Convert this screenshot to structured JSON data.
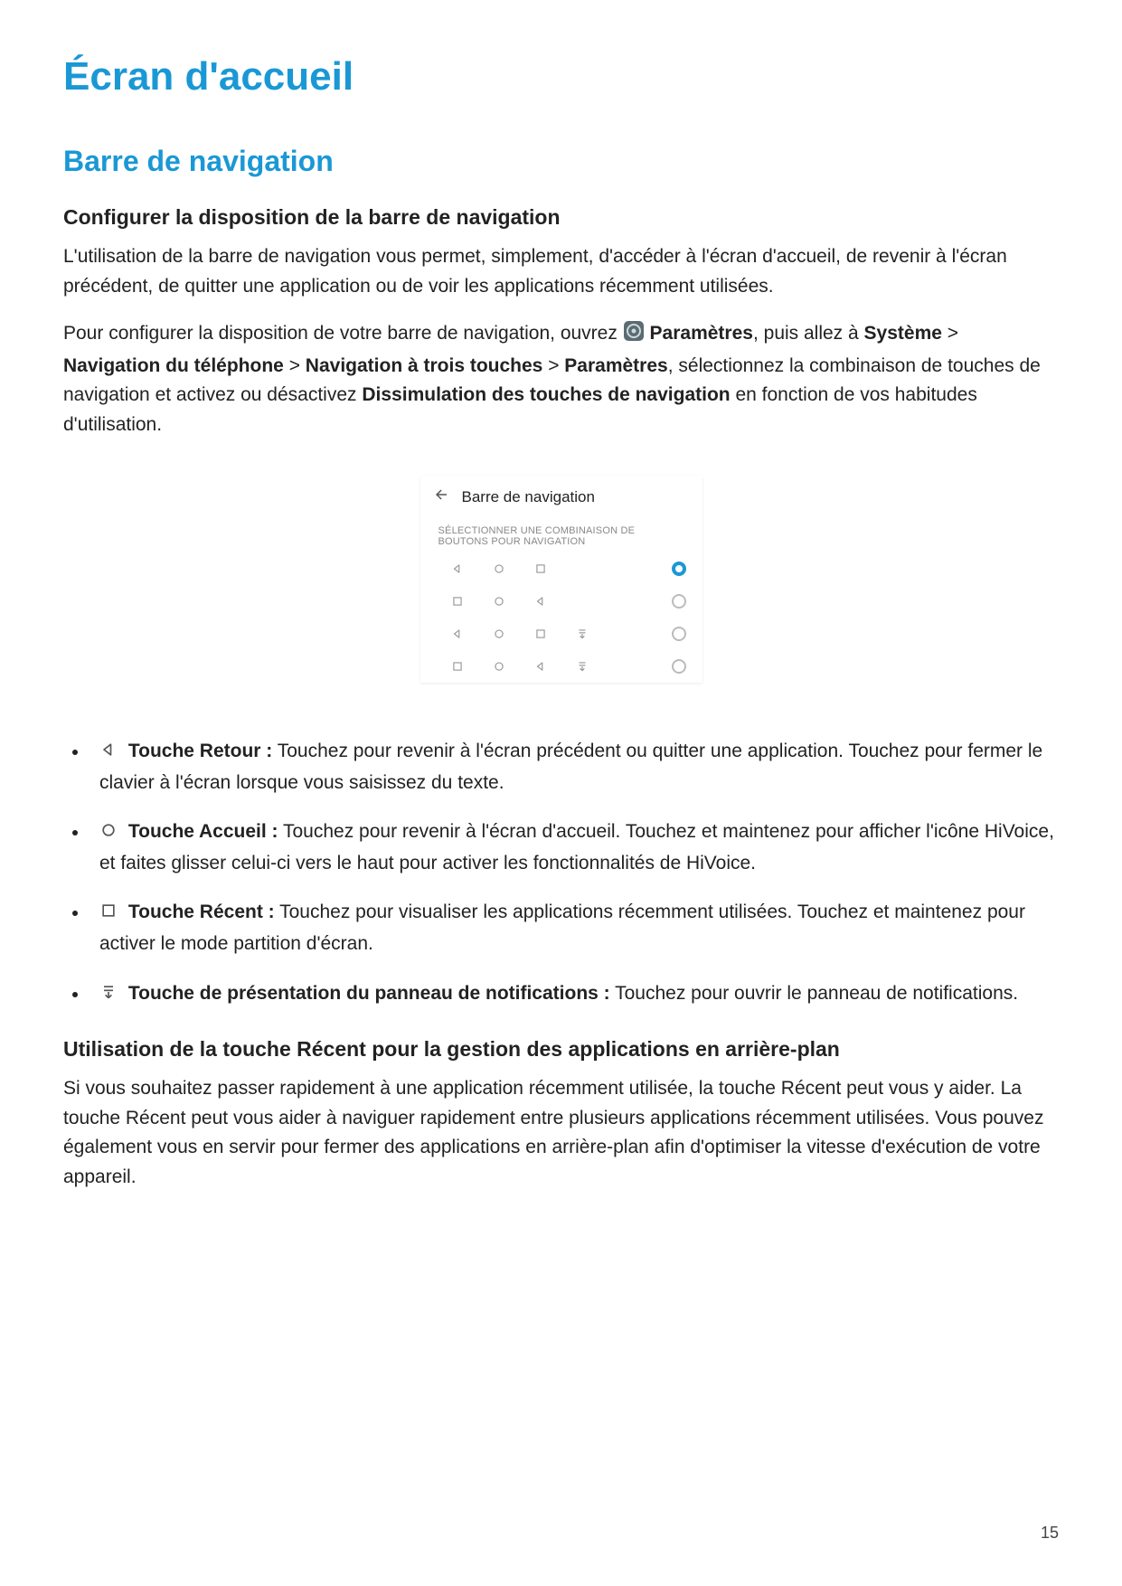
{
  "pageNumber": "15",
  "title": "Écran d'accueil",
  "section": "Barre de navigation",
  "sub1": {
    "heading": "Configurer la disposition de la barre de navigation",
    "p1": "L'utilisation de la barre de navigation vous permet, simplement, d'accéder à l'écran d'accueil, de revenir à l'écran précédent, de quitter une application ou de voir les applications récemment utilisées.",
    "p2_pre": "Pour configurer la disposition de votre barre de navigation, ouvrez ",
    "p2_b1": "Paramètres",
    "p2_mid1": ", puis allez à ",
    "p2_b2": "Système",
    "p2_sep": " > ",
    "p2_b3": "Navigation du téléphone",
    "p2_b4": "Navigation à trois touches",
    "p2_b5": "Paramètres",
    "p2_mid2": ", sélectionnez la combinaison de touches de navigation et activez ou désactivez ",
    "p2_b6": "Dissimulation des touches de navigation",
    "p2_tail": " en fonction de vos habitudes d'utilisation."
  },
  "illustration": {
    "header": "Barre de navigation",
    "subheader": "SÉLECTIONNER UNE COMBINAISON DE BOUTONS POUR NAVIGATION",
    "rows": [
      {
        "cells": [
          "back",
          "home",
          "recent",
          null
        ],
        "selected": true
      },
      {
        "cells": [
          "recent",
          "home",
          "back",
          null
        ],
        "selected": false
      },
      {
        "cells": [
          "back",
          "home",
          "recent",
          "notif"
        ],
        "selected": false
      },
      {
        "cells": [
          "recent",
          "home",
          "back",
          "notif"
        ],
        "selected": false
      }
    ]
  },
  "keys": [
    {
      "icon": "back",
      "title": "Touche Retour :",
      "desc": " Touchez pour revenir à l'écran précédent ou quitter une application. Touchez pour fermer le clavier à l'écran lorsque vous saisissez du texte."
    },
    {
      "icon": "home",
      "title": "Touche Accueil :",
      "desc": " Touchez pour revenir à l'écran d'accueil. Touchez et maintenez pour afficher l'icône HiVoice, et faites glisser celui-ci vers le haut pour activer les fonctionnalités de HiVoice."
    },
    {
      "icon": "recent",
      "title": "Touche Récent :",
      "desc": " Touchez pour visualiser les applications récemment utilisées. Touchez et maintenez pour activer le mode partition d'écran."
    },
    {
      "icon": "notif",
      "title": "Touche de présentation du panneau de notifications :",
      "desc": " Touchez pour ouvrir le panneau de notifications."
    }
  ],
  "sub2": {
    "heading": "Utilisation de la touche Récent pour la gestion des applications en arrière-plan",
    "p1": "Si vous souhaitez passer rapidement à une application récemment utilisée, la touche Récent peut vous y aider. La touche Récent peut vous aider à naviguer rapidement entre plusieurs applications récemment utilisées. Vous pouvez également vous en servir pour fermer des applications en arrière-plan afin d'optimiser la vitesse d'exécution de votre appareil."
  }
}
